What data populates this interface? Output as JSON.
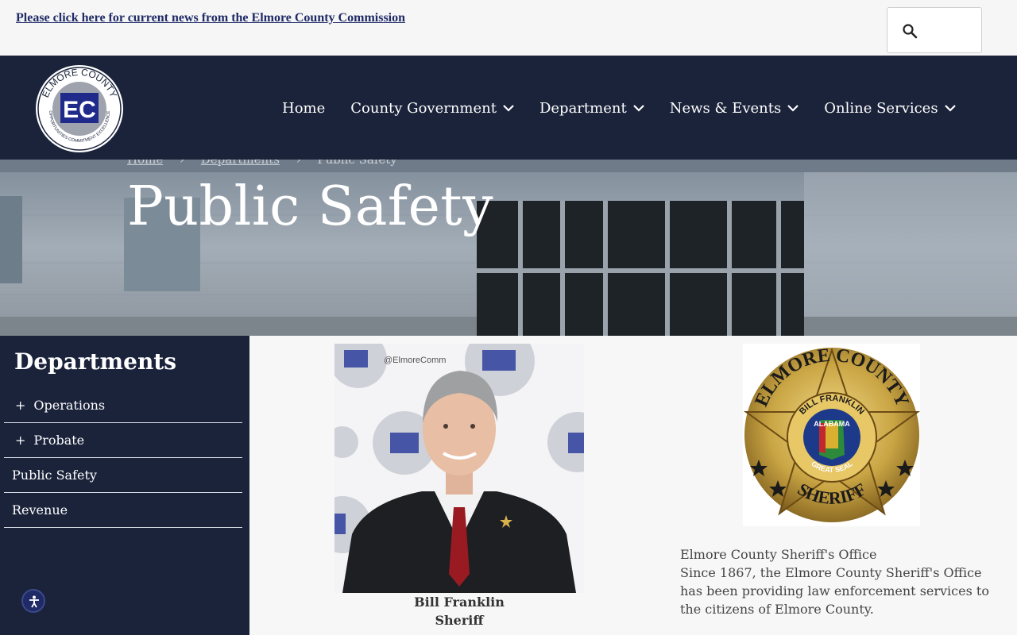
{
  "topbar": {
    "news_link": "Please click here for current news from the Elmore County Commission",
    "search_icon": "search-icon"
  },
  "logo": {
    "arc_text": "ELMORE COUNTY",
    "monogram": "EC",
    "bottom_text": "OPPORTUNITIES COMMITMENT EXCELLENCE"
  },
  "nav": {
    "items": [
      {
        "label": "Home",
        "dropdown": false
      },
      {
        "label": "County Government",
        "dropdown": true
      },
      {
        "label": "Department",
        "dropdown": true
      },
      {
        "label": "News & Events",
        "dropdown": true
      },
      {
        "label": "Online Services",
        "dropdown": true
      }
    ]
  },
  "breadcrumb": {
    "items": [
      "Home",
      "Departments",
      "Public Safety"
    ],
    "separator": "›"
  },
  "hero": {
    "title": "Public Safety"
  },
  "sidebar": {
    "heading": "Departments",
    "items": [
      {
        "label": "Operations",
        "expandable": true
      },
      {
        "label": "Probate",
        "expandable": true
      },
      {
        "label": "Public Safety",
        "expandable": false
      },
      {
        "label": "Revenue",
        "expandable": false
      }
    ]
  },
  "sheriff": {
    "name": "Bill Franklin",
    "title": "Sheriff",
    "backdrop_text": "@ElmoreComm"
  },
  "badge": {
    "top_text": "ELMORE COUNTY",
    "inner_text": "BILL FRANKLIN",
    "state_text": "ALABAMA",
    "seal_text": "GREAT SEAL",
    "bottom_text": "SHERIFF"
  },
  "about": {
    "heading": "Elmore County Sheriff's Office",
    "body": "Since 1867, the Elmore County Sheriff's Office has been providing law enforcement services to the citizens of Elmore County."
  },
  "colors": {
    "navy": "#1b233b",
    "link": "#1f2a66",
    "gold": "#c9a544"
  }
}
